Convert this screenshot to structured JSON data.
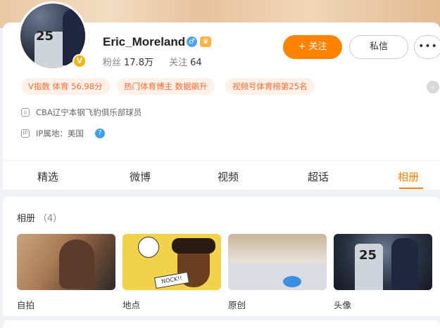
{
  "profile": {
    "name": "Eric_Moreland",
    "vbadge": "V",
    "gender_icon": "male-icon",
    "crown_icon": "crown-icon",
    "fans_label": "粉丝",
    "fans_value": "17.8万",
    "following_label": "关注",
    "following_value": "64"
  },
  "actions": {
    "follow": "+ 关注",
    "message": "私信",
    "more": "•••"
  },
  "tags": [
    "V指数 体育 56.98分",
    "热门体育博主 数据飙升",
    "视频号体育榜第25名"
  ],
  "info": {
    "affiliation": "CBA辽宁本钢飞豹俱乐部球员",
    "ip_label": "IP属地：美国",
    "help": "?"
  },
  "tabs": [
    "精选",
    "微博",
    "视频",
    "超话",
    "相册"
  ],
  "active_tab": "相册",
  "album": {
    "title": "相册",
    "count": "（4）",
    "items": [
      {
        "caption": "自拍"
      },
      {
        "caption": "地点"
      },
      {
        "caption": "原创"
      },
      {
        "caption": "头像"
      }
    ],
    "comic_text": "NOCK!!"
  },
  "colors": {
    "accent": "#ff8200",
    "tag_bg": "#fff1e8",
    "tag_text": "#ff6a33"
  }
}
